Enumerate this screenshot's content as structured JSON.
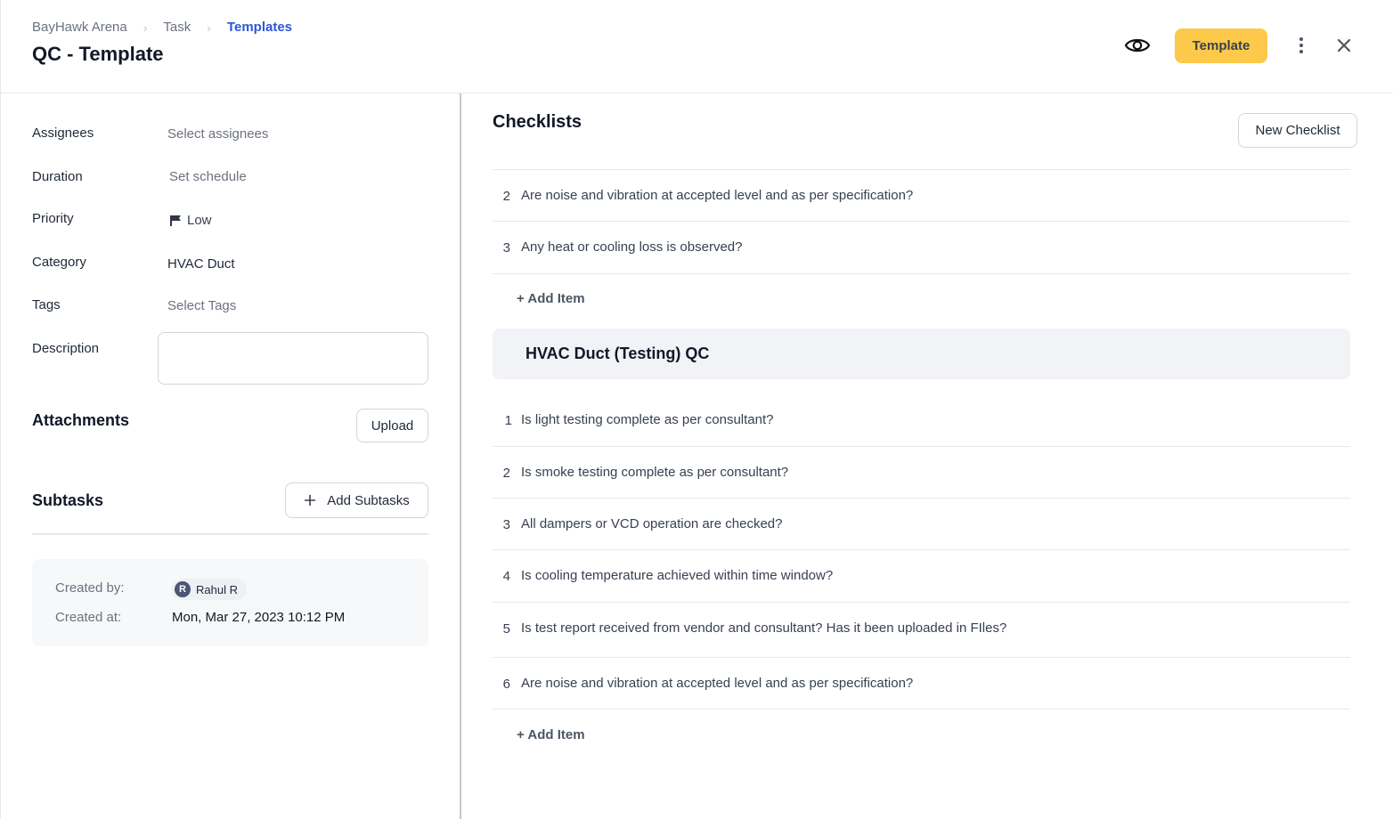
{
  "header": {
    "breadcrumb": [
      {
        "label": "BayHawk Arena",
        "active": false
      },
      {
        "label": "Task",
        "active": false
      },
      {
        "label": "Templates",
        "active": true
      }
    ],
    "title": "QC - Template",
    "template_button": "Template",
    "icons": {
      "preview": "eye-icon",
      "more": "more-vertical-icon",
      "close": "close-icon"
    }
  },
  "details": {
    "assignees": {
      "label": "Assignees",
      "placeholder": "Select assignees"
    },
    "duration": {
      "label": "Duration",
      "placeholder": "Set schedule"
    },
    "priority": {
      "label": "Priority",
      "value": "Low",
      "icon": "flag-icon"
    },
    "category": {
      "label": "Category",
      "value": "HVAC Duct"
    },
    "tags": {
      "label": "Tags",
      "placeholder": "Select Tags"
    },
    "description": {
      "label": "Description",
      "value": ""
    }
  },
  "attachments": {
    "title": "Attachments",
    "upload_button": "Upload"
  },
  "subtasks": {
    "title": "Subtasks",
    "add_button": "Add Subtasks"
  },
  "meta": {
    "created_by_label": "Created by:",
    "created_by": {
      "initial": "R",
      "name": "Rahul R"
    },
    "created_at_label": "Created at:",
    "created_at": "Mon, Mar 27, 2023 10:12 PM"
  },
  "checklists": {
    "title": "Checklists",
    "new_button": "New Checklist",
    "groups": [
      {
        "title": "",
        "items": [
          {
            "num": "2",
            "text": "Are noise and vibration at accepted level and as per specification?"
          },
          {
            "num": "3",
            "text": "Any heat or cooling loss is observed?"
          }
        ],
        "add_item": "+ Add Item"
      },
      {
        "title": "HVAC Duct (Testing) QC",
        "items": [
          {
            "num": "1",
            "text": "Is light testing complete as per consultant?"
          },
          {
            "num": "2",
            "text": "Is smoke testing complete as per consultant?"
          },
          {
            "num": "3",
            "text": "All dampers or VCD operation are checked?"
          },
          {
            "num": "4",
            "text": "Is cooling temperature achieved within time window?"
          },
          {
            "num": "5",
            "text": "Is test report received from vendor and consultant? Has it been uploaded in FIles?"
          },
          {
            "num": "6",
            "text": "Are noise and vibration at accepted level and as per specification?"
          }
        ],
        "add_item": "+ Add Item"
      }
    ]
  },
  "colors": {
    "accent_yellow": "#fcc94a",
    "breadcrumb_active": "#2b57d9",
    "avatar_bg": "#4b5574"
  }
}
